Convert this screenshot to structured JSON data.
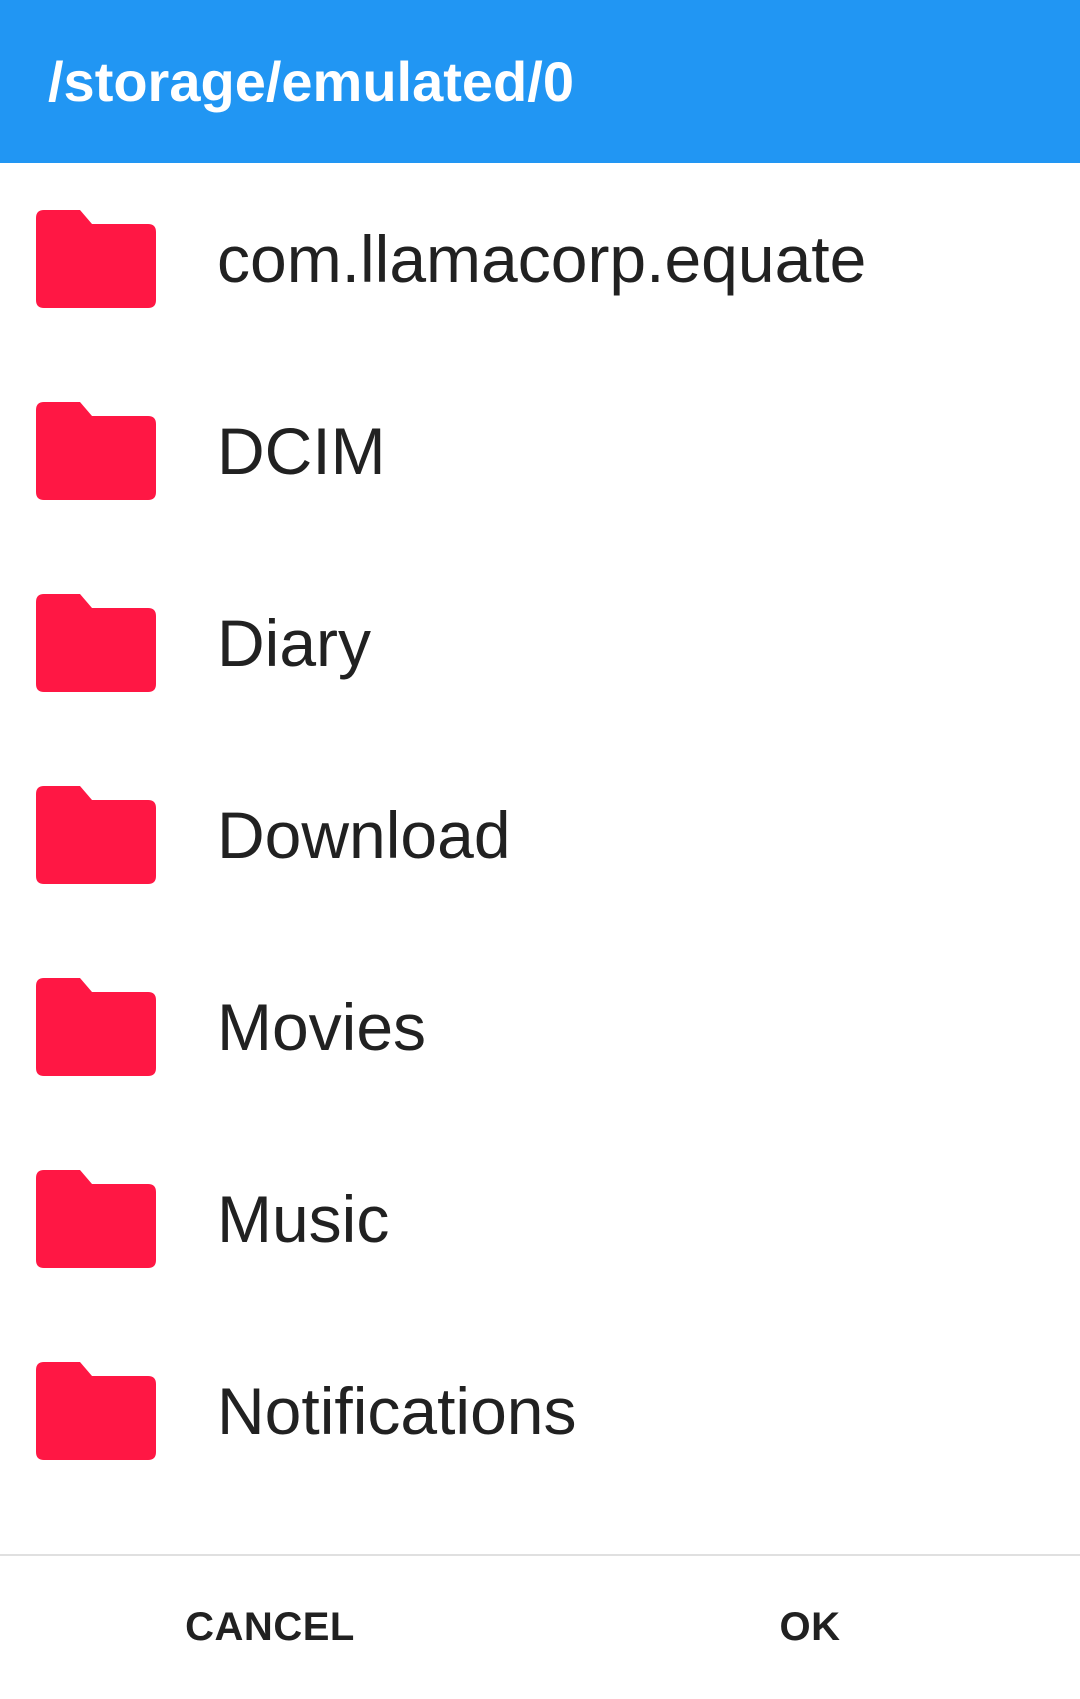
{
  "header": {
    "title": "/storage/emulated/0"
  },
  "folder_color": "#FF1744",
  "folder_icon": "folder-icon",
  "folders": [
    {
      "name": "com.llamacorp.equate"
    },
    {
      "name": "DCIM"
    },
    {
      "name": "Diary"
    },
    {
      "name": "Download"
    },
    {
      "name": "Movies"
    },
    {
      "name": "Music"
    },
    {
      "name": "Notifications"
    }
  ],
  "buttons": {
    "cancel_label": "CANCEL",
    "ok_label": "OK"
  }
}
